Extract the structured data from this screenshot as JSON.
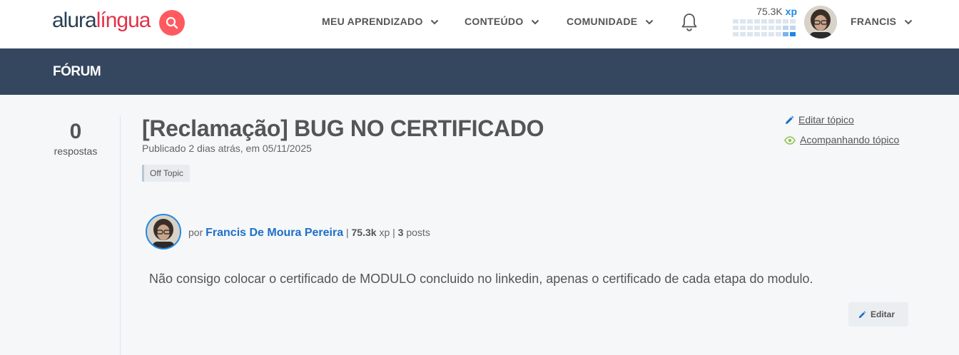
{
  "header": {
    "logo_part1": "alura",
    "logo_part2": "língua",
    "nav": [
      {
        "label": "MEU APRENDIZADO"
      },
      {
        "label": "CONTEÚDO"
      },
      {
        "label": "COMUNIDADE"
      }
    ],
    "xp_value": "75.3K",
    "xp_unit": "xp",
    "user_name": "FRANCIS",
    "icons": [
      "search-icon",
      "bell-icon",
      "chevron-down-icon",
      "avatar"
    ]
  },
  "forum_bar": {
    "title": "FÓRUM"
  },
  "topic": {
    "reply_count": "0",
    "reply_label": "respostas",
    "title": "[Reclamação] BUG NO CERTIFICADO",
    "published": "Publicado 2 dias atrás, em 05/11/2025",
    "tag": "Off Topic",
    "edit_topic_label": "Editar tópico",
    "follow_topic_label": "Acompanhando tópico"
  },
  "post": {
    "by_label": "por",
    "author": "Francis De Moura Pereira",
    "xp": "75.3k",
    "xp_unit": "xp",
    "posts_count": "3",
    "posts_label": "posts",
    "body": "Não consigo colocar o certificado de MODULO concluido no linkedin, apenas o certificado de cada etapa do modulo.",
    "edit_label": "Editar"
  },
  "colors": {
    "brand_dark": "#34475e",
    "brand_red": "#ff5a5f",
    "link_blue": "#1e6fc8",
    "follow_green": "#8bc34a"
  }
}
